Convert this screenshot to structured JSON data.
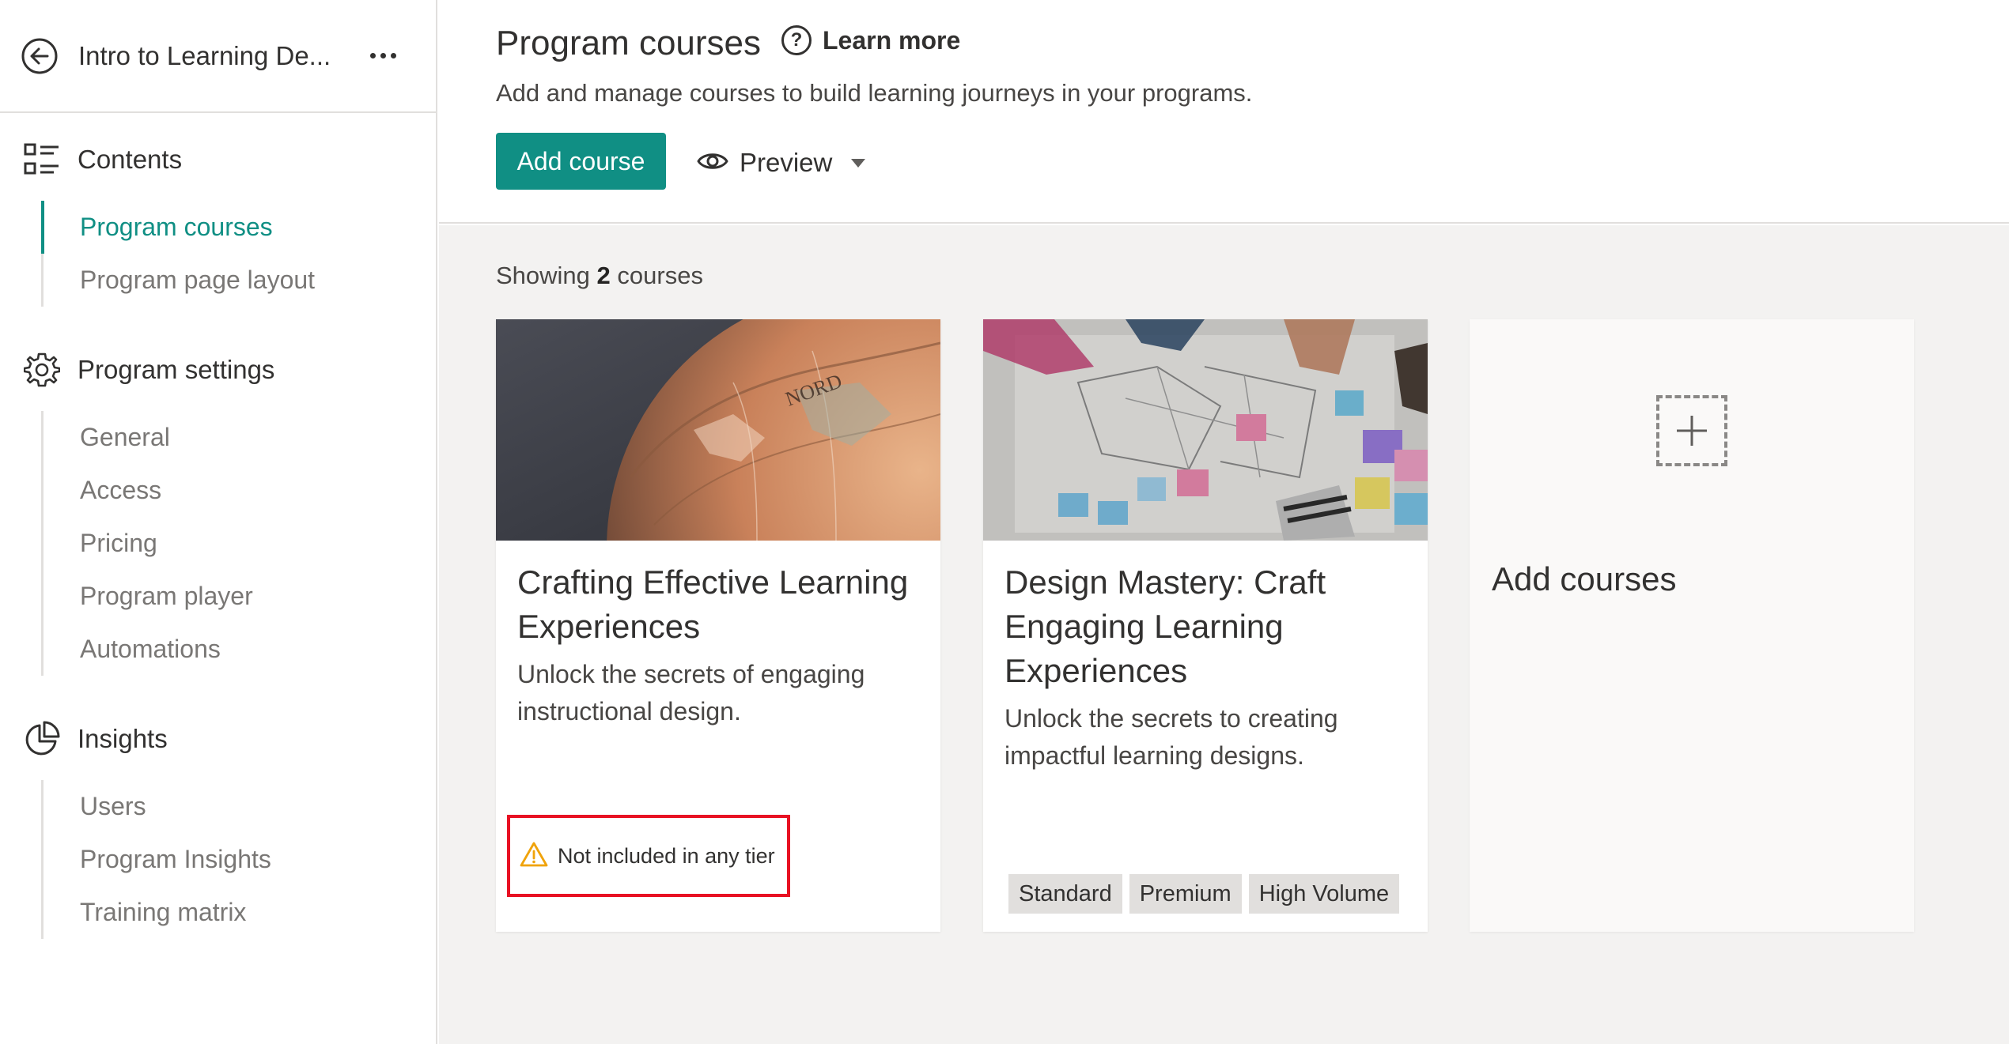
{
  "sidebar": {
    "title": "Intro to Learning De...",
    "sections": [
      {
        "label": "Contents",
        "icon": "list-icon",
        "items": [
          "Program courses",
          "Program page layout"
        ]
      },
      {
        "label": "Program settings",
        "icon": "gear-icon",
        "items": [
          "General",
          "Access",
          "Pricing",
          "Program player",
          "Automations"
        ]
      },
      {
        "label": "Insights",
        "icon": "pie-chart-icon",
        "items": [
          "Users",
          "Program Insights",
          "Training matrix"
        ]
      }
    ],
    "active_item": "Program courses"
  },
  "header": {
    "title": "Program courses",
    "learn_more": "Learn more",
    "subtitle": "Add and manage courses to build learning journeys in your programs.",
    "add_course": "Add course",
    "preview": "Preview"
  },
  "content": {
    "showing_prefix": "Showing",
    "count": "2",
    "showing_suffix": "courses",
    "courses": [
      {
        "title": "Crafting Effective Learning Experiences",
        "description": "Unlock the secrets of engaging instructional design.",
        "warning": "Not included in any tier",
        "tags": []
      },
      {
        "title": "Design Mastery: Craft Engaging Learning Experiences",
        "description": "Unlock the secrets to creating impactful learning designs.",
        "warning": "",
        "tags": [
          "Standard",
          "Premium",
          "High Volume"
        ]
      }
    ],
    "add_courses": "Add courses"
  },
  "colors": {
    "accent": "#108f84",
    "warning": "#f0a30a",
    "highlight_border": "#e81123"
  }
}
